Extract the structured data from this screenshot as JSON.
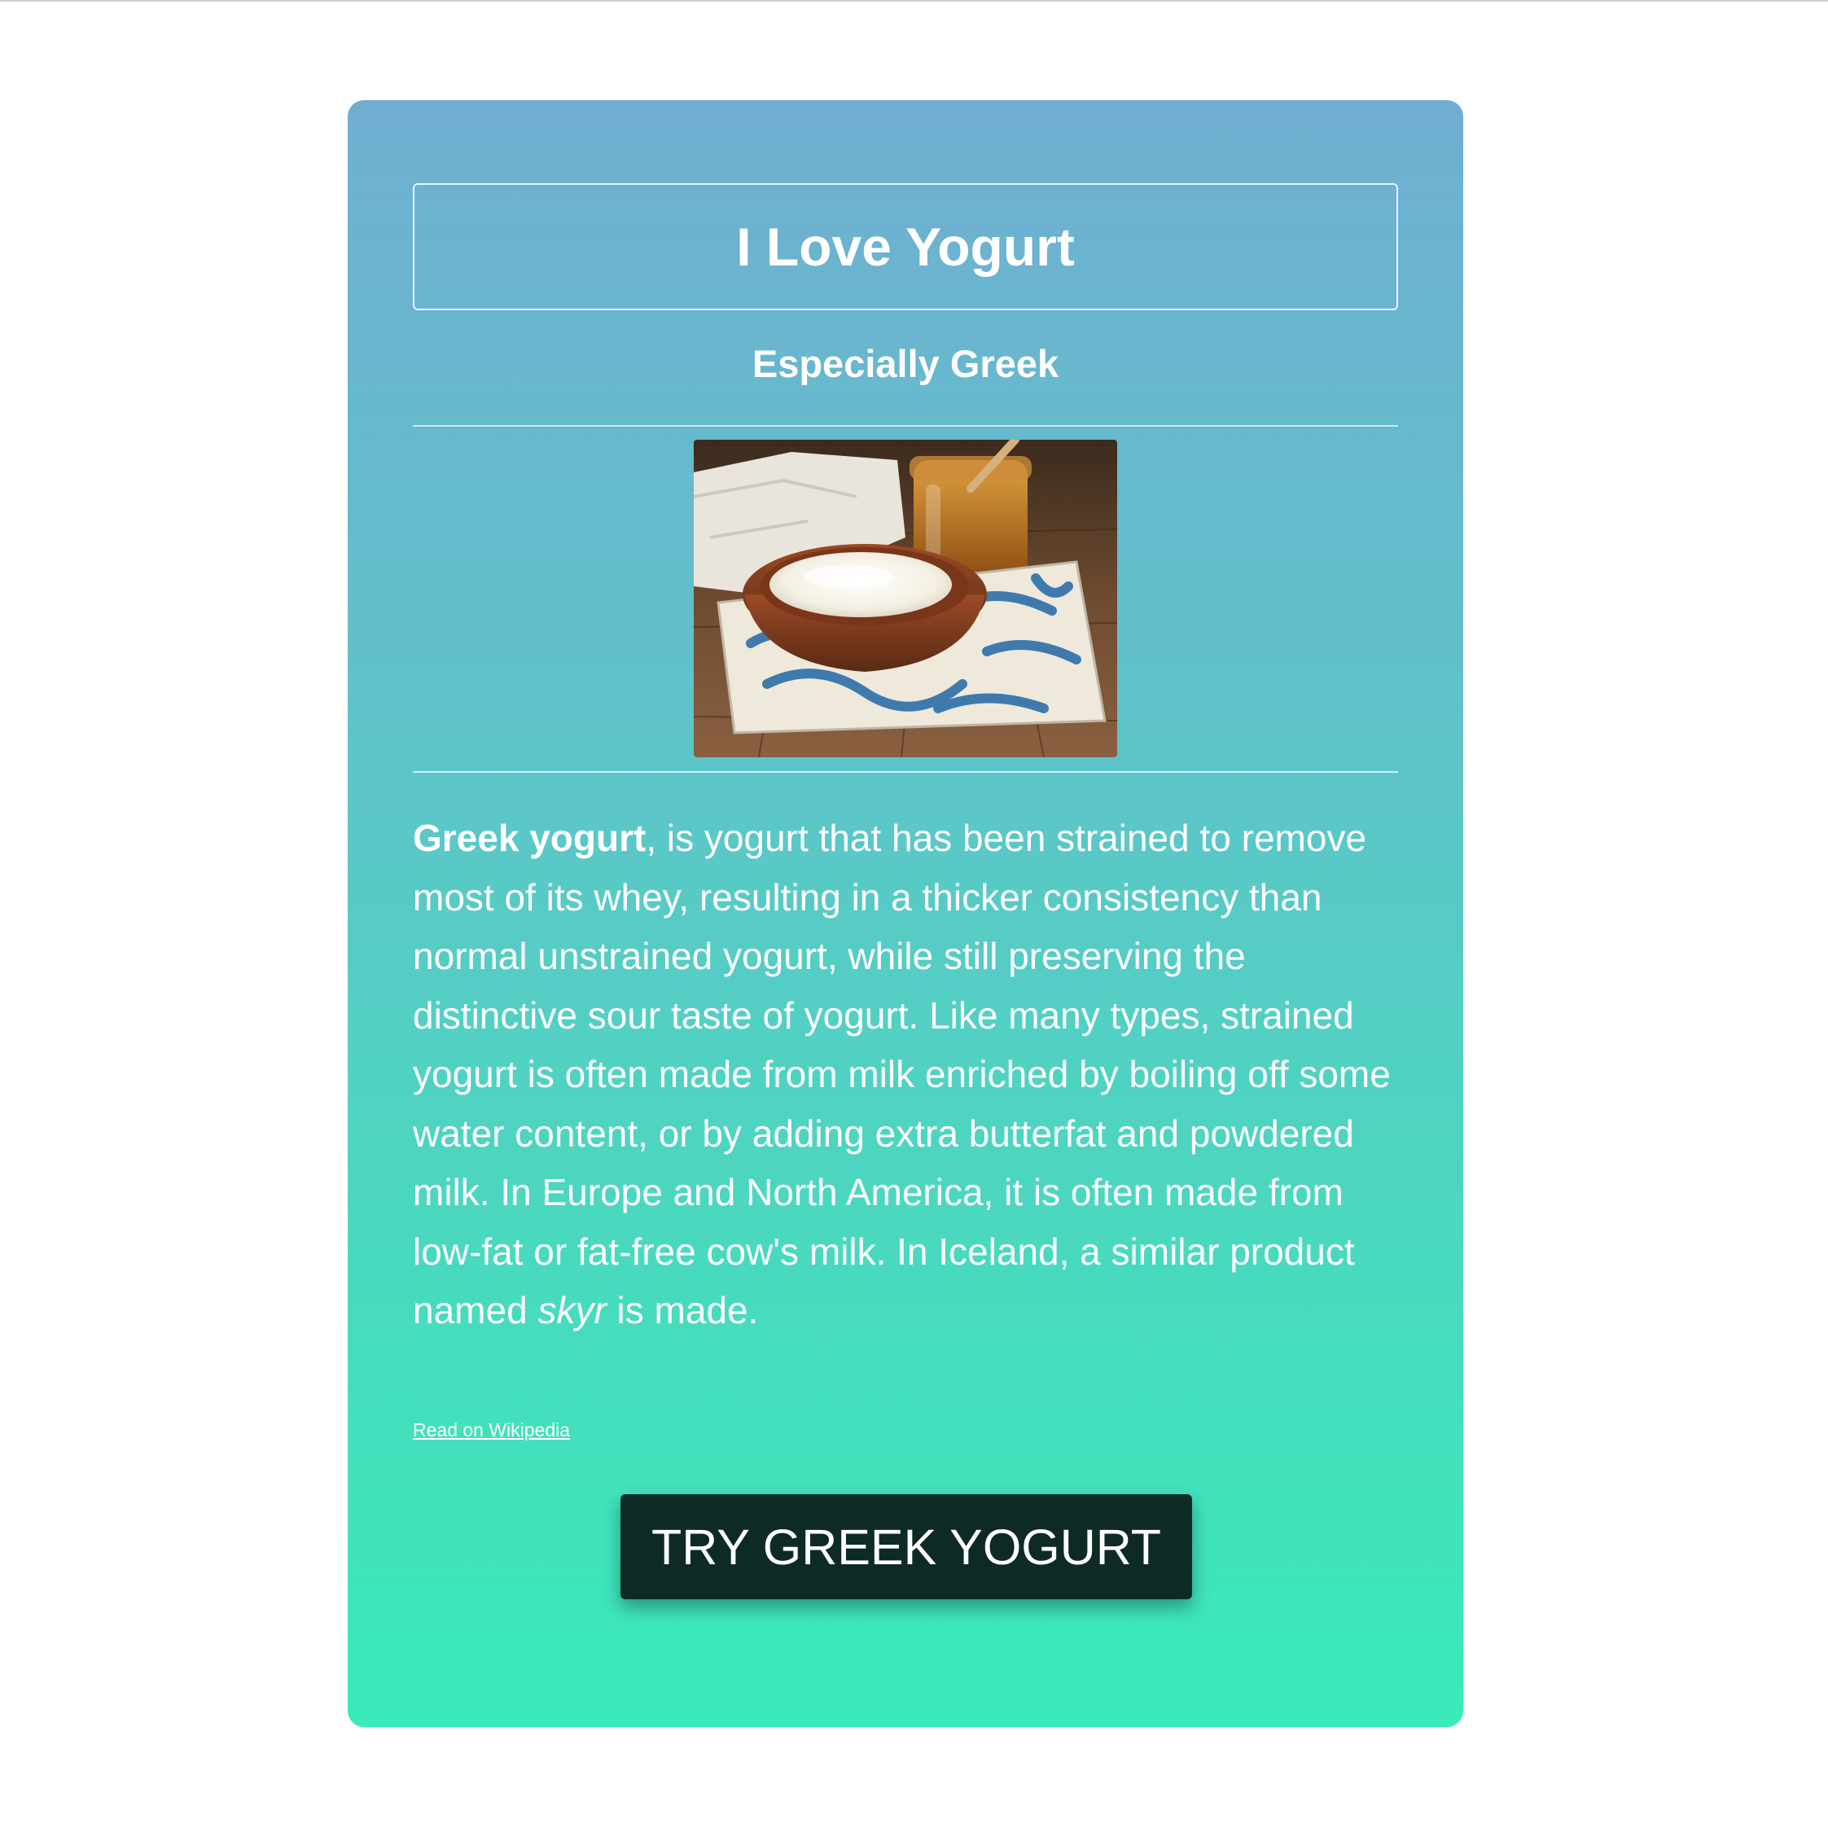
{
  "card": {
    "title": "I Love Yogurt",
    "subtitle": "Especially Greek",
    "image_alt": "Bowl of Greek yogurt with honey jar on a blue patterned tile",
    "description": {
      "bold_lead": "Greek yogurt",
      "part1": ", is yogurt that has been strained to remove most of its whey, resulting in a thicker consistency than normal unstrained yogurt, while still preserving the distinctive sour taste of yogurt. Like many types, strained yogurt is often made from milk enriched by boiling off some water content, or by adding extra butterfat and powdered milk. In Europe and North America, it is often made from low-fat or fat-free cow's milk. In Iceland, a similar product named ",
      "italic_word": "skyr",
      "part2": " is made."
    },
    "link_label": "Read on Wikipedia",
    "cta_label": "TRY GREEK YOGURT"
  },
  "colors": {
    "gradient_top": "#70aed1",
    "gradient_bottom": "#3aeabb",
    "cta_background": "#0d2b24",
    "text": "#ffffff"
  }
}
